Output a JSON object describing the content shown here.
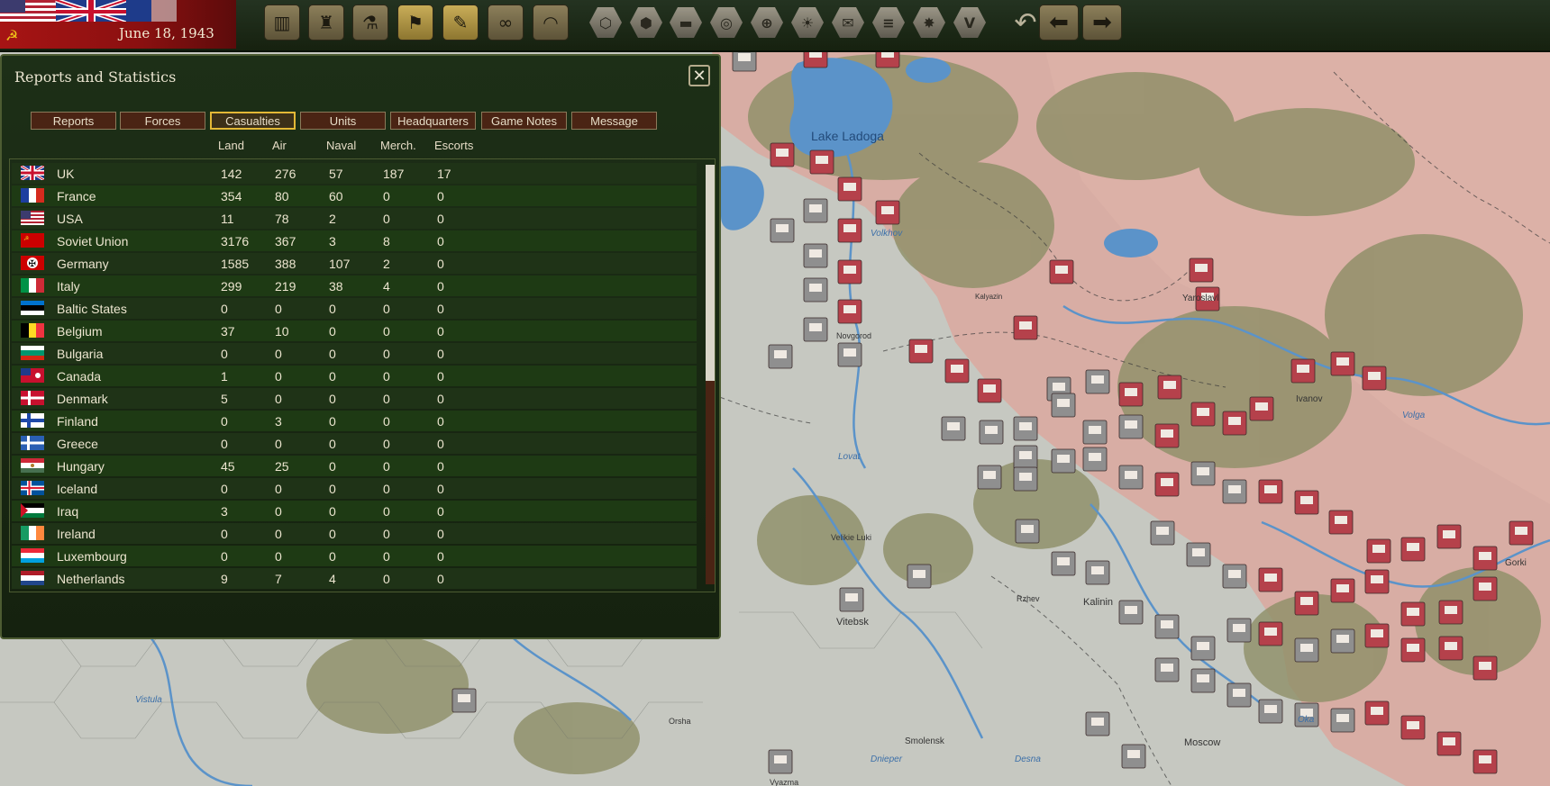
{
  "header": {
    "date": "June 18, 1943"
  },
  "toolbar": {
    "buttons": [
      {
        "name": "production-button",
        "icon": "factory-icon",
        "glyph": "▥"
      },
      {
        "name": "diplomacy-button",
        "icon": "building-icon",
        "glyph": "♜"
      },
      {
        "name": "research-button",
        "icon": "microscope-icon",
        "glyph": "⚗"
      },
      {
        "name": "objectives-button",
        "icon": "flag-icon",
        "glyph": "⚑"
      },
      {
        "name": "reports-button",
        "icon": "report-icon",
        "glyph": "✎"
      },
      {
        "name": "intelligence-button",
        "icon": "binoculars-icon",
        "glyph": "∞"
      },
      {
        "name": "units-button",
        "icon": "helmet-icon",
        "glyph": "◠"
      }
    ],
    "hex_buttons": [
      {
        "name": "hex-grid-button",
        "icon": "hexagon-icon",
        "glyph": "⬡"
      },
      {
        "name": "supply-hex-button",
        "icon": "hex-cluster-icon",
        "glyph": "⬢"
      },
      {
        "name": "tank-filter-button",
        "icon": "tank-icon",
        "glyph": "▬"
      },
      {
        "name": "resources-button",
        "icon": "coins-icon",
        "glyph": "◎"
      },
      {
        "name": "target-button",
        "icon": "crosshair-icon",
        "glyph": "⊕"
      },
      {
        "name": "weather-button",
        "icon": "sun-icon",
        "glyph": "☀"
      },
      {
        "name": "envelope-button",
        "icon": "envelope-icon",
        "glyph": "✉"
      },
      {
        "name": "fleet-button",
        "icon": "ship-icon",
        "glyph": "≡"
      },
      {
        "name": "explosion-button",
        "icon": "explosion-icon",
        "glyph": "✸"
      },
      {
        "name": "victory-button",
        "icon": "victory-icon",
        "glyph": "V"
      }
    ]
  },
  "panel": {
    "title": "Reports and Statistics",
    "tabs": [
      "Reports",
      "Forces",
      "Casualties",
      "Units",
      "Headquarters",
      "Game Notes",
      "Message"
    ],
    "active_tab": "Casualties",
    "columns": [
      "Land",
      "Air",
      "Naval",
      "Merch.",
      "Escorts"
    ],
    "rows": [
      {
        "country": "UK",
        "flag": "uk",
        "values": [
          "142",
          "276",
          "57",
          "187",
          "17"
        ]
      },
      {
        "country": "France",
        "flag": "france",
        "values": [
          "354",
          "80",
          "60",
          "0",
          "0"
        ]
      },
      {
        "country": "USA",
        "flag": "usa",
        "values": [
          "11",
          "78",
          "2",
          "0",
          "0"
        ]
      },
      {
        "country": "Soviet Union",
        "flag": "soviet",
        "values": [
          "3176",
          "367",
          "3",
          "8",
          "0"
        ]
      },
      {
        "country": "Germany",
        "flag": "germany",
        "values": [
          "1585",
          "388",
          "107",
          "2",
          "0"
        ]
      },
      {
        "country": "Italy",
        "flag": "italy",
        "values": [
          "299",
          "219",
          "38",
          "4",
          "0"
        ]
      },
      {
        "country": "Baltic States",
        "flag": "baltic",
        "values": [
          "0",
          "0",
          "0",
          "0",
          "0"
        ]
      },
      {
        "country": "Belgium",
        "flag": "belgium",
        "values": [
          "37",
          "10",
          "0",
          "0",
          "0"
        ]
      },
      {
        "country": "Bulgaria",
        "flag": "bulgaria",
        "values": [
          "0",
          "0",
          "0",
          "0",
          "0"
        ]
      },
      {
        "country": "Canada",
        "flag": "canada",
        "values": [
          "1",
          "0",
          "0",
          "0",
          "0"
        ]
      },
      {
        "country": "Denmark",
        "flag": "denmark",
        "values": [
          "5",
          "0",
          "0",
          "0",
          "0"
        ]
      },
      {
        "country": "Finland",
        "flag": "finland",
        "values": [
          "0",
          "3",
          "0",
          "0",
          "0"
        ]
      },
      {
        "country": "Greece",
        "flag": "greece",
        "values": [
          "0",
          "0",
          "0",
          "0",
          "0"
        ]
      },
      {
        "country": "Hungary",
        "flag": "hungary",
        "values": [
          "45",
          "25",
          "0",
          "0",
          "0"
        ]
      },
      {
        "country": "Iceland",
        "flag": "iceland",
        "values": [
          "0",
          "0",
          "0",
          "0",
          "0"
        ]
      },
      {
        "country": "Iraq",
        "flag": "iraq",
        "values": [
          "3",
          "0",
          "0",
          "0",
          "0"
        ]
      },
      {
        "country": "Ireland",
        "flag": "ireland",
        "values": [
          "0",
          "0",
          "0",
          "0",
          "0"
        ]
      },
      {
        "country": "Luxembourg",
        "flag": "luxembourg",
        "values": [
          "0",
          "0",
          "0",
          "0",
          "0"
        ]
      },
      {
        "country": "Netherlands",
        "flag": "netherlands",
        "values": [
          "9",
          "7",
          "4",
          "0",
          "0"
        ]
      }
    ]
  },
  "map": {
    "cities": [
      {
        "label": "Lake Ladoga",
        "kind": "lake"
      },
      {
        "label": "Volkhov",
        "kind": "blue"
      },
      {
        "label": "Novgorod",
        "kind": "city"
      },
      {
        "label": "Lovat",
        "kind": "blue"
      },
      {
        "label": "Velikie Luki",
        "kind": "city"
      },
      {
        "label": "Vitebsk",
        "kind": "city"
      },
      {
        "label": "Kalinin",
        "kind": "city"
      },
      {
        "label": "Rzhev",
        "kind": "city"
      },
      {
        "label": "Moscow",
        "kind": "city"
      },
      {
        "label": "Smolensk",
        "kind": "city"
      },
      {
        "label": "Dnieper",
        "kind": "blue"
      },
      {
        "label": "Desna",
        "kind": "blue"
      },
      {
        "label": "Oka",
        "kind": "blue"
      },
      {
        "label": "Volga",
        "kind": "blue"
      },
      {
        "label": "Ivanov",
        "kind": "city"
      },
      {
        "label": "Gorki",
        "kind": "city"
      },
      {
        "label": "Orsha",
        "kind": "city"
      },
      {
        "label": "Vyazma",
        "kind": "city"
      },
      {
        "label": "Yaroslavl",
        "kind": "city"
      },
      {
        "label": "Kalyazin",
        "kind": "city"
      },
      {
        "label": "Vistula",
        "kind": "blue"
      }
    ]
  },
  "colors": {
    "soviet_territory": "#d7aba2",
    "axis_territory": "#c9cbc4",
    "lake": "#5b93c9",
    "forest": "#8f906a",
    "soviet_unit": "#b5414b",
    "axis_unit": "#8f8f8f",
    "active_tab_border": "#e3b836"
  }
}
